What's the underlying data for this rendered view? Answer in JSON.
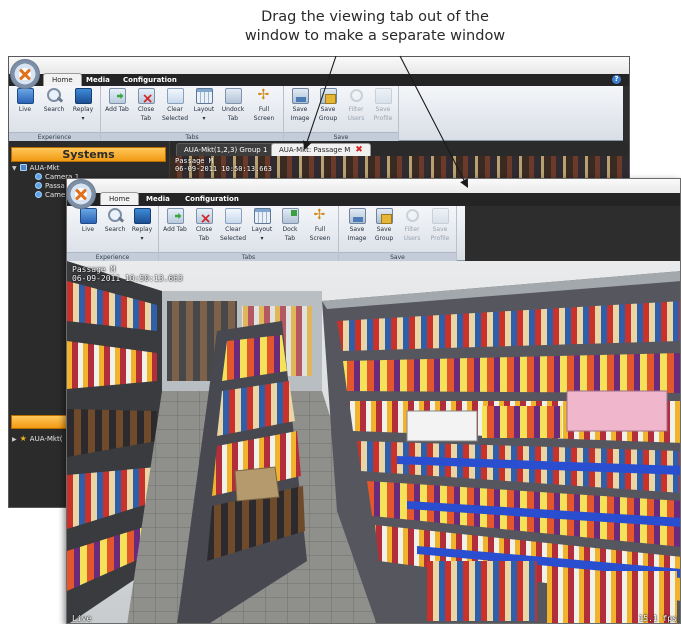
{
  "caption": {
    "line1": "Drag the viewing tab out of the",
    "line2": "window to make a separate window"
  },
  "menu": {
    "home": "Home",
    "media": "Media",
    "configuration": "Configuration",
    "help": "?"
  },
  "ribbon": {
    "groups": {
      "experience": "Experience",
      "tabs": "Tabs",
      "save": "Save"
    },
    "buttons": {
      "live": "Live",
      "search": "Search",
      "replay": "Replay",
      "add_tab": "Add Tab",
      "close_tab_1": "Close",
      "close_tab_2": "Tab",
      "clear_selected_1": "Clear",
      "clear_selected_2": "Selected",
      "layout": "Layout",
      "undock_tab_1": "Undock",
      "undock_tab_2": "Tab",
      "dock_tab_1": "Dock",
      "dock_tab_2": "Tab",
      "full_screen_1": "Full",
      "full_screen_2": "Screen",
      "save_image_1": "Save",
      "save_image_2": "Image",
      "save_group_1": "Save",
      "save_group_2": "Group",
      "filter_users_1": "Filter",
      "filter_users_2": "Users",
      "save_profile_1": "Save",
      "save_profile_2": "Profile",
      "dropdown_marker": "▾"
    }
  },
  "sidebar": {
    "title": "Systems",
    "system": "AUA-Mkt",
    "cameras": [
      "Camera 1",
      "Passa",
      "Came"
    ],
    "favorites": "AUA-Mkt("
  },
  "view_tabs": {
    "group_tab": "AUA-Mkt(1,2,3) Group 1",
    "camera_tab": "AUA-Mkt: Passage M",
    "close_glyph": "✖"
  },
  "osd": {
    "camera_name": "Passage M",
    "timestamp": "06-09-2011 10:50:13.663",
    "mode": "Live",
    "fps": "15.1 fps"
  },
  "colors": {
    "accent_orange": "#f29a12",
    "menu_dark": "#242424",
    "close_red": "#d62424"
  }
}
